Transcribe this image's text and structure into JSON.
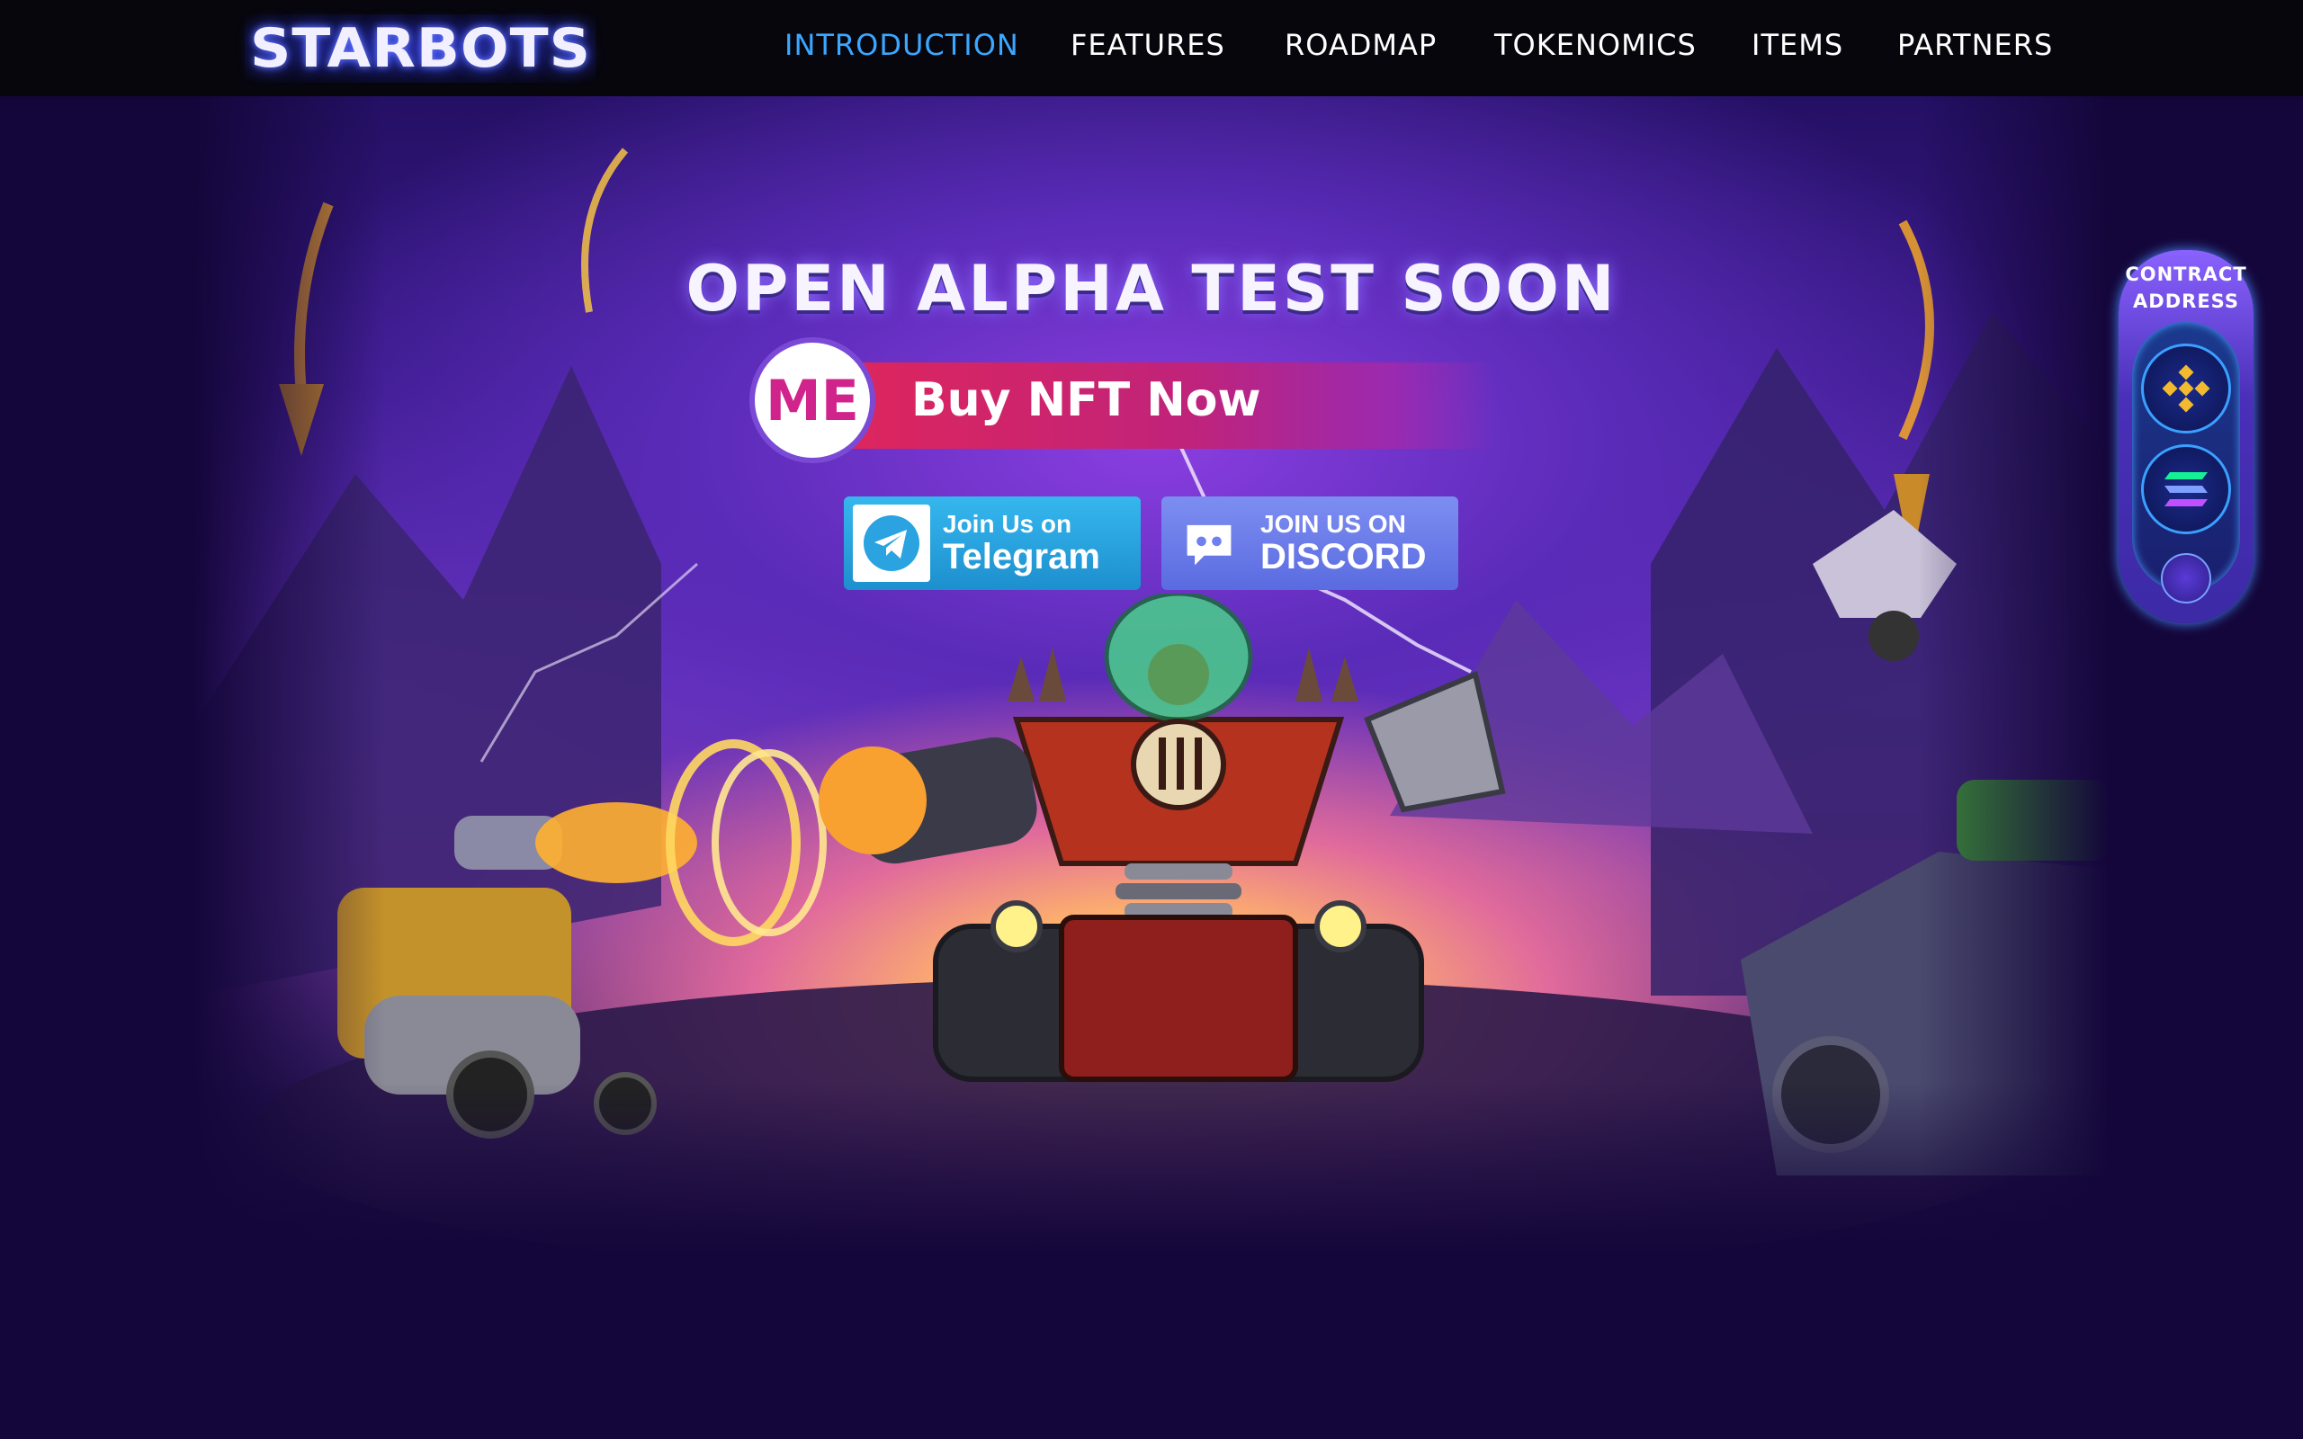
{
  "header": {
    "logo_text": "STARBOTS",
    "nav": [
      {
        "label": "INTRODUCTION",
        "active": true
      },
      {
        "label": "FEATURES",
        "active": false
      },
      {
        "label": "ROADMAP",
        "active": false
      },
      {
        "label": "TOKENOMICS",
        "active": false
      },
      {
        "label": "ITEMS",
        "active": false
      },
      {
        "label": "PARTNERS",
        "active": false
      }
    ]
  },
  "hero": {
    "headline": "OPEN ALPHA TEST SOON",
    "buy_button": {
      "badge": "ME",
      "label": "Buy NFT Now"
    },
    "telegram": {
      "line1": "Join Us on",
      "line2": "Telegram"
    },
    "discord": {
      "line1": "JOIN US ON",
      "line2": "DISCORD"
    }
  },
  "contract_panel": {
    "title_line1": "CONTRACT",
    "title_line2": "ADDRESS",
    "icons": [
      "binance-icon",
      "solana-icon"
    ]
  },
  "colors": {
    "nav_active": "#3ba7ff",
    "topbar_bg": "#07060d",
    "page_bg": "#14063a",
    "telegram": "#2aa3e0",
    "discord": "#6e7ff0",
    "buy_button": "#e0265a"
  }
}
